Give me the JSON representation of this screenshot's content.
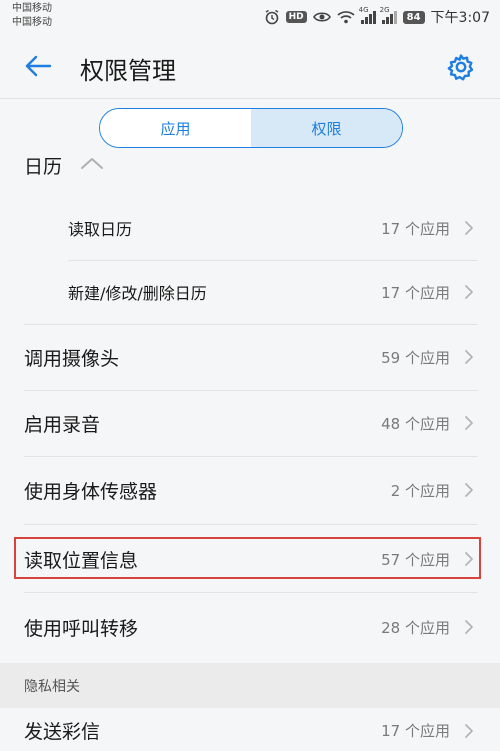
{
  "status_bar": {
    "carrier_1": "中国移动",
    "carrier_2": "中国移动",
    "hd": "HD",
    "net_1": "4G",
    "net_2": "2G",
    "battery": "84",
    "time": "下午3:07"
  },
  "toolbar": {
    "title": "权限管理"
  },
  "segments": {
    "app": "应用",
    "permission": "权限",
    "selected": "permission"
  },
  "calendar": {
    "header": "日历",
    "items": [
      {
        "label": "读取日历",
        "count": "17 个应用"
      },
      {
        "label": "新建/修改/删除日历",
        "count": "17 个应用"
      }
    ]
  },
  "permissions": [
    {
      "label": "调用摄像头",
      "count": "59 个应用"
    },
    {
      "label": "启用录音",
      "count": "48 个应用"
    },
    {
      "label": "使用身体传感器",
      "count": "2 个应用"
    },
    {
      "label": "读取位置信息",
      "count": "57 个应用"
    },
    {
      "label": "使用呼叫转移",
      "count": "28 个应用"
    }
  ],
  "privacy_section": {
    "title": "隐私相关",
    "items": [
      {
        "label": "发送彩信",
        "count": "17 个应用"
      }
    ]
  },
  "colors": {
    "accent": "#1e7fe0",
    "highlight_box": "#d9433f"
  }
}
